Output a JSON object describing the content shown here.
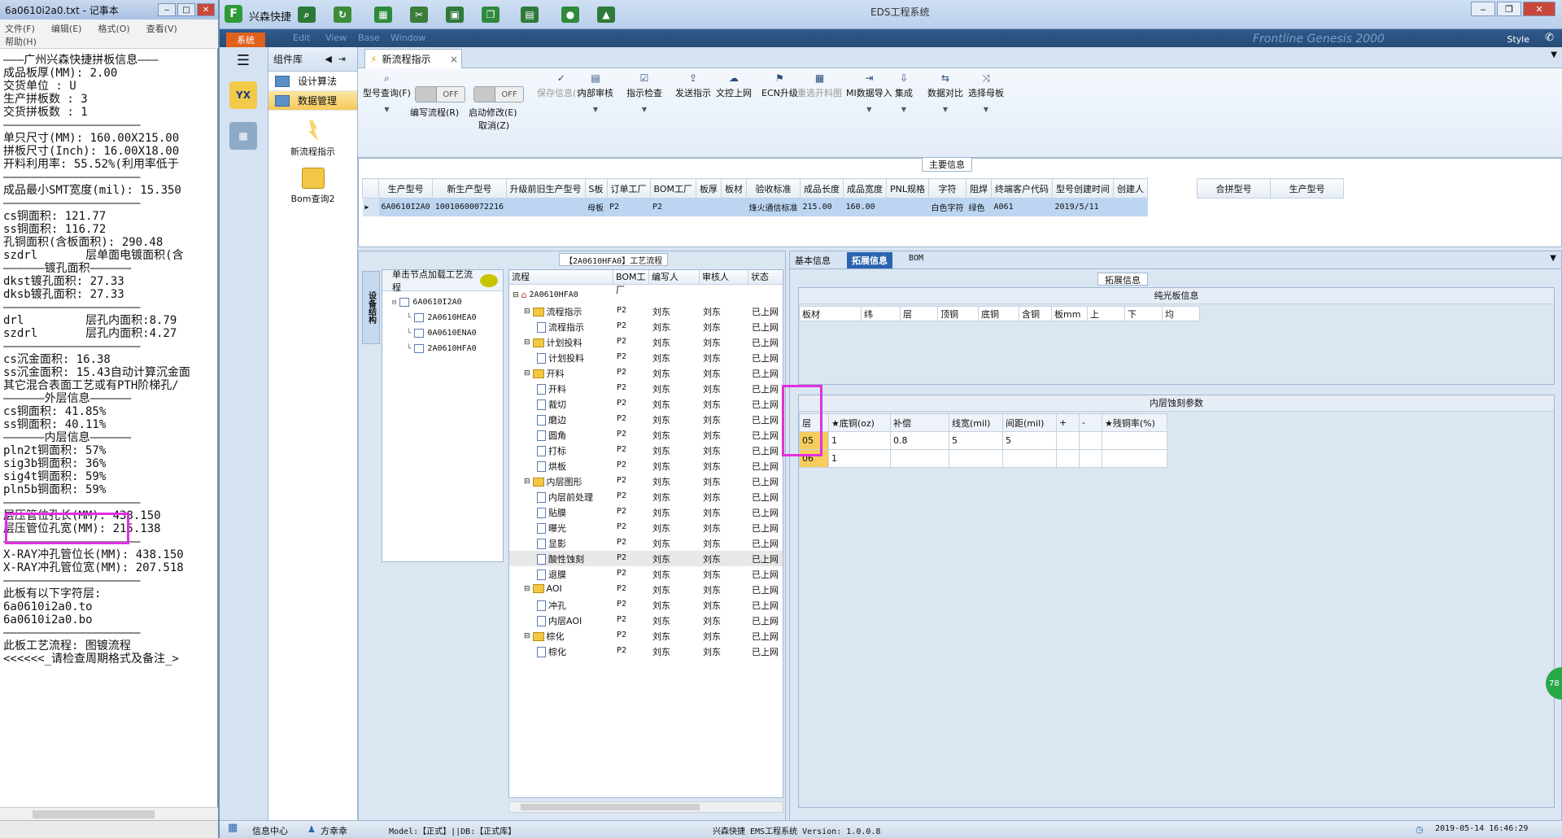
{
  "notepad": {
    "title": "6a0610i2a0.txt - 记事本",
    "menu": [
      "文件(F)",
      "编辑(E)",
      "格式(O)",
      "查看(V)",
      "帮助(H)"
    ],
    "lines": [
      "———广州兴森快捷拼板信息———",
      "成品板厚(MM): 2.00",
      "交货单位 : U",
      "生产拼板数 : 3",
      "交货拼板数 : 1",
      "————————————————————",
      "单只尺寸(MM): 160.00X215.00",
      "拼板尺寸(Inch): 16.00X18.00",
      "开料利用率: 55.52%(利用率低于",
      "————————————————————",
      "成品最小SMT宽度(mil): 15.350",
      "————————————————————",
      "cs铜面积: 121.77",
      "ss铜面积: 116.72",
      "孔铜面积(含板面积): 290.48",
      "szdrl       层单面电镀面积(含",
      "——————镀孔面积——————",
      "dkst镀孔面积: 27.33",
      "dksb镀孔面积: 27.33",
      "————————————————————",
      "drl         层孔内面积:8.79",
      "szdrl       层孔内面积:4.27",
      "————————————————————",
      "cs沉金面积: 16.38",
      "ss沉金面积: 15.43自动计算沉金面",
      "其它混合表面工艺或有PTH阶梯孔/",
      "——————外层信息——————",
      "cs铜面积: 41.85%",
      "ss铜面积: 40.11%",
      "——————内层信息——————",
      "pln2t铜面积: 57%",
      "sig3b铜面积: 36%",
      "sig4t铜面积: 59%",
      "pln5b铜面积: 59%",
      "————————————————————",
      "层压管位孔长(MM): 438.150",
      "层压管位孔宽(MM): 215.138",
      "————————————————————",
      "X-RAY冲孔管位长(MM): 438.150",
      "X-RAY冲孔管位宽(MM): 207.518",
      "————————————————————",
      "此板有以下字符层:",
      "6a0610i2a0.to",
      "6a0610i2a0.bo",
      "————————————————————",
      "此板工艺流程: 图镀流程",
      "<<<<<<_请检查周期格式及备注_>"
    ]
  },
  "app": {
    "title": "EDS工程系统",
    "brand": "兴森快捷",
    "sys_tab": "系统",
    "style_label": "Style",
    "ghost_menu": [
      "Edit",
      "View",
      "Base",
      "Window"
    ],
    "ghost_brand": "Frontline  Genesis 2000"
  },
  "component_panel": {
    "header": "组件库",
    "items": [
      {
        "label": "设计算法",
        "selected": false
      },
      {
        "label": "数据管理",
        "selected": true
      }
    ],
    "buttons": [
      "新流程指示",
      "Bom查询2"
    ]
  },
  "doc_tab": {
    "label": "新流程指示",
    "close": "×"
  },
  "toolbar": {
    "buttons": [
      {
        "label": "型号查询(F)",
        "dropdown": true,
        "disabled": false,
        "icon": "search-icon",
        "glyph": "⌕"
      },
      {
        "label": "保存信息(S)",
        "dropdown": false,
        "disabled": true,
        "icon": "check-icon",
        "glyph": "✓"
      },
      {
        "label": "内部审核",
        "dropdown": true,
        "disabled": false,
        "icon": "printer-icon",
        "glyph": "▤"
      },
      {
        "label": "指示检查",
        "dropdown": true,
        "disabled": false,
        "icon": "checkbox-icon",
        "glyph": "☑"
      },
      {
        "label": "发送指示",
        "dropdown": false,
        "disabled": false,
        "icon": "upload-icon",
        "glyph": "⇪"
      },
      {
        "label": "文控上网",
        "dropdown": false,
        "disabled": false,
        "icon": "cloud-upload-icon",
        "glyph": "☁"
      },
      {
        "label": "ECN升级",
        "dropdown": false,
        "disabled": false,
        "icon": "ecn-icon",
        "glyph": "⚑"
      },
      {
        "label": "重选开料图",
        "dropdown": false,
        "disabled": true,
        "icon": "image-icon",
        "glyph": "▦"
      },
      {
        "label": "MI数据导入",
        "dropdown": true,
        "disabled": false,
        "icon": "import-icon",
        "glyph": "⇥"
      },
      {
        "label": "集成",
        "dropdown": true,
        "disabled": false,
        "icon": "download-icon",
        "glyph": "⇩"
      },
      {
        "label": "数据对比",
        "dropdown": true,
        "disabled": false,
        "icon": "compare-icon",
        "glyph": "⇆"
      },
      {
        "label": "选择母板",
        "dropdown": true,
        "disabled": false,
        "icon": "shuffle-icon",
        "glyph": "⤨"
      }
    ],
    "toggles": [
      {
        "state": "OFF",
        "label": "编写流程(R)"
      },
      {
        "state": "OFF",
        "label": "启动修改(E)",
        "sub": "取消(Z)"
      }
    ]
  },
  "main_info": {
    "title": "主要信息",
    "columns": [
      "生产型号",
      "新生产型号",
      "升级前旧生产型号",
      "S板",
      "订单工厂",
      "BOM工厂",
      "板厚",
      "板材",
      "验收标准",
      "成品长度",
      "成品宽度",
      "PNL规格",
      "字符",
      "阻焊",
      "终端客户代码",
      "型号创建时间",
      "创建人"
    ],
    "row": [
      "6A0610I2A0",
      "10010600072216",
      "",
      "母板",
      "P2",
      "P2",
      "",
      "",
      "烽火通信标准",
      "215.00",
      "160.00",
      "",
      "白色字符",
      "绿色",
      "A061",
      "2019/5/11",
      ""
    ],
    "right_columns": [
      "合拼型号",
      "生产型号"
    ]
  },
  "process": {
    "title": "【2A0610HFA0】工艺流程",
    "vtab": "设备结构",
    "node_header": "单击节点加载工艺流程",
    "nodes": [
      "6A0610I2A0",
      "2A0610HEA0",
      "0A0610ENA0",
      "2A0610HFA0"
    ],
    "columns": [
      "流程",
      "BOM工厂",
      "编写人",
      "审核人",
      "状态"
    ],
    "root": "2A0610HFA0",
    "rows": [
      {
        "name": "流程指示",
        "folder": true,
        "level": 1
      },
      {
        "name": "流程指示",
        "folder": false,
        "level": 2
      },
      {
        "name": "计划投料",
        "folder": true,
        "level": 1
      },
      {
        "name": "计划投料",
        "folder": false,
        "level": 2
      },
      {
        "name": "开料",
        "folder": true,
        "level": 1
      },
      {
        "name": "开料",
        "folder": false,
        "level": 2
      },
      {
        "name": "裁切",
        "folder": false,
        "level": 2
      },
      {
        "name": "磨边",
        "folder": false,
        "level": 2
      },
      {
        "name": "圆角",
        "folder": false,
        "level": 2
      },
      {
        "name": "打标",
        "folder": false,
        "level": 2
      },
      {
        "name": "烘板",
        "folder": false,
        "level": 2
      },
      {
        "name": "内层图形",
        "folder": true,
        "level": 1
      },
      {
        "name": "内层前处理",
        "folder": false,
        "level": 2
      },
      {
        "name": "贴膜",
        "folder": false,
        "level": 2
      },
      {
        "name": "曝光",
        "folder": false,
        "level": 2
      },
      {
        "name": "显影",
        "folder": false,
        "level": 2
      },
      {
        "name": "酸性蚀刻",
        "folder": false,
        "level": 2,
        "highlight": true
      },
      {
        "name": "退膜",
        "folder": false,
        "level": 2
      },
      {
        "name": "AOI",
        "folder": true,
        "level": 1
      },
      {
        "name": "冲孔",
        "folder": false,
        "level": 2
      },
      {
        "name": "内层AOI",
        "folder": false,
        "level": 2
      },
      {
        "name": "棕化",
        "folder": true,
        "level": 1
      },
      {
        "name": "棕化",
        "folder": false,
        "level": 2
      }
    ],
    "bom_factory": "P2",
    "author": "刘东",
    "reviewer": "刘东",
    "status": "已上网"
  },
  "detail": {
    "tabs": [
      {
        "label": "基本信息",
        "active": false
      },
      {
        "label": "拓展信息",
        "active": true
      },
      {
        "label": "BOM",
        "active": false
      }
    ],
    "section": "拓展信息",
    "pure_title": "纯光板信息",
    "pure_cols": [
      "板材",
      "纬",
      "层",
      "顶铜",
      "底铜",
      "含铜",
      "板mm",
      "上",
      "下",
      "均"
    ],
    "inner_title": "内层蚀刻参数",
    "inner_cols": [
      "层",
      "★底铜(oz)",
      "补偿",
      "线宽(mil)",
      "间距(mil)",
      "+",
      "-",
      "★残铜率(%)"
    ],
    "inner_rows": [
      [
        "05",
        "1",
        "0.8",
        "5",
        "5",
        "",
        "",
        ""
      ],
      [
        "06",
        "1",
        "",
        "",
        "",
        "",
        "",
        ""
      ]
    ]
  },
  "status": {
    "info_center": "信息中心",
    "user": "方幸幸",
    "model": "Model:【正式】||DB:【正式库】",
    "version": "兴森快捷 EMS工程系统 Version: 1.0.0.8",
    "datetime": "2019-05-14 16:46:29",
    "badge": "78"
  }
}
